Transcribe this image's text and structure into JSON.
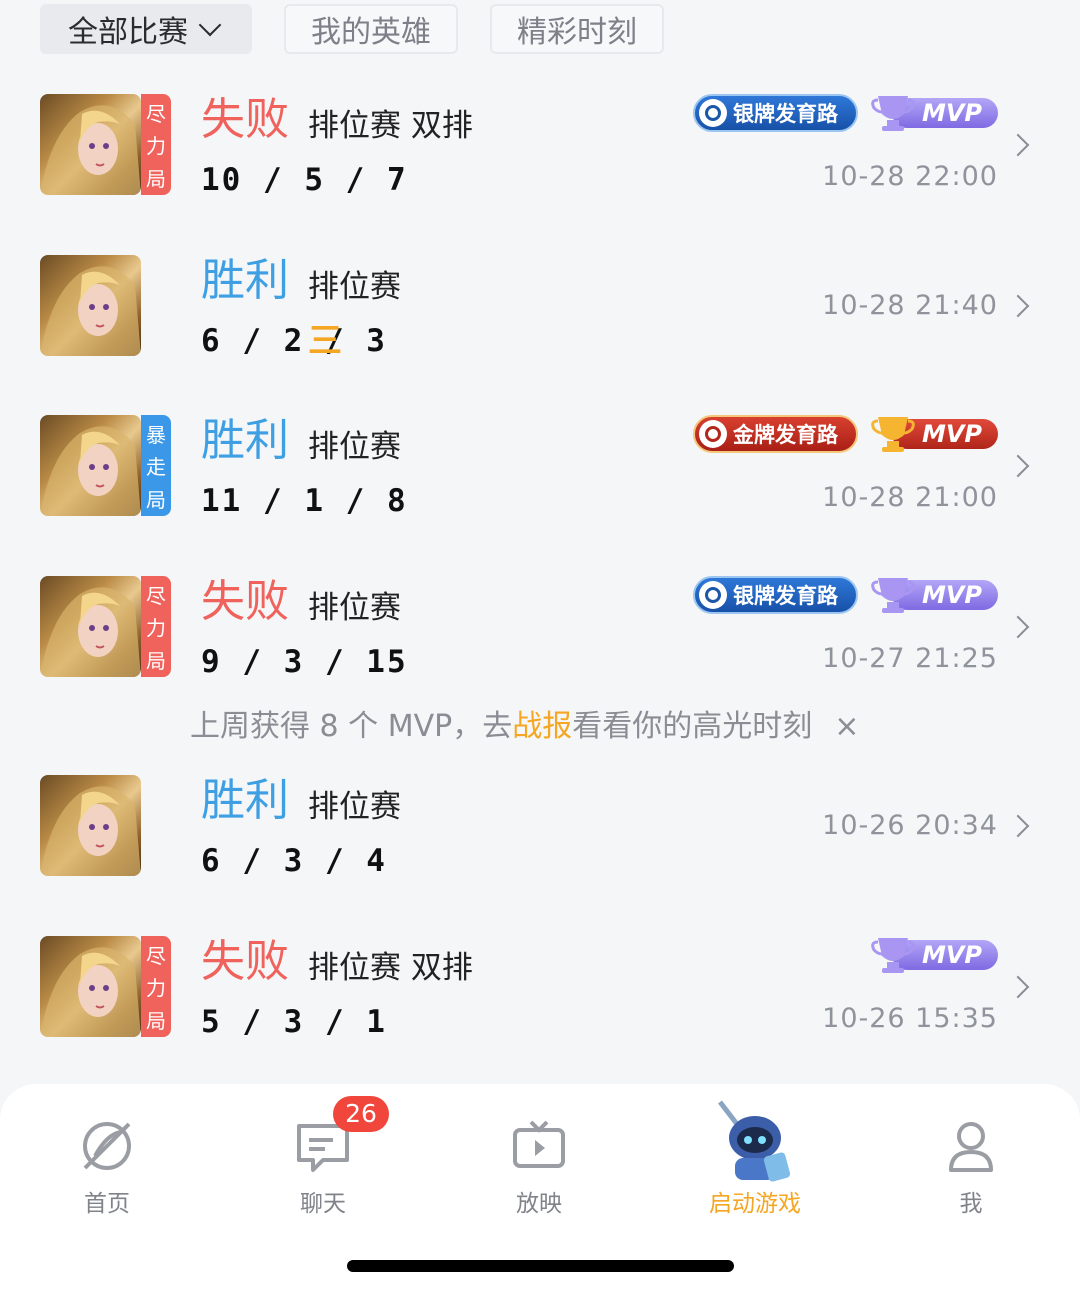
{
  "filters": [
    {
      "label": "全部比赛",
      "active": true
    },
    {
      "label": "我的英雄",
      "active": false
    },
    {
      "label": "精彩时刻",
      "active": false
    }
  ],
  "matches": [
    {
      "tag": [
        "尽",
        "力",
        "局"
      ],
      "tag_color": "red",
      "result": "失败",
      "result_type": "lose",
      "mode": "排位赛 双排",
      "kda": "10 / 5 / 7",
      "rank_badge": "银牌发育路",
      "rank_type": "silver",
      "mvp": "MVP",
      "mvp_type": "purple",
      "time": "10-28 22:00"
    },
    {
      "tag": null,
      "result": "胜利",
      "result_type": "win",
      "mode": "排位赛",
      "kda": "6 / 2 / 3",
      "triple": "三",
      "time": "10-28 21:40"
    },
    {
      "tag": [
        "暴",
        "走",
        "局"
      ],
      "tag_color": "blue",
      "result": "胜利",
      "result_type": "win",
      "mode": "排位赛",
      "kda": "11 / 1 / 8",
      "rank_badge": "金牌发育路",
      "rank_type": "gold",
      "mvp": "MVP",
      "mvp_type": "red",
      "time": "10-28 21:00"
    },
    {
      "tag": [
        "尽",
        "力",
        "局"
      ],
      "tag_color": "red",
      "result": "失败",
      "result_type": "lose",
      "mode": "排位赛",
      "kda": "9 / 3 / 15",
      "rank_badge": "银牌发育路",
      "rank_type": "silver",
      "mvp": "MVP",
      "mvp_type": "purple",
      "time": "10-27 21:25"
    },
    {
      "tag": null,
      "result": "胜利",
      "result_type": "win",
      "mode": "排位赛",
      "kda": "6 / 3 / 4",
      "time": "10-26 20:34"
    },
    {
      "tag": [
        "尽",
        "力",
        "局"
      ],
      "tag_color": "red",
      "result": "失败",
      "result_type": "lose",
      "mode": "排位赛 双排",
      "kda": "5 / 3 / 1",
      "mvp": "MVP",
      "mvp_type": "purple",
      "time": "10-26 15:35"
    }
  ],
  "notice": {
    "prefix": "上周获得 8 个 MVP，去",
    "highlight": "战报",
    "suffix": "看看你的高光时刻",
    "close": "×"
  },
  "nav": {
    "items": [
      {
        "label": "首页",
        "icon": "home-icon"
      },
      {
        "label": "聊天",
        "icon": "chat-icon",
        "badge": "26"
      },
      {
        "label": "放映",
        "icon": "tv-icon"
      },
      {
        "label": "启动游戏",
        "icon": "game-mascot-icon",
        "active": true
      },
      {
        "label": "我",
        "icon": "profile-icon"
      }
    ]
  },
  "colors": {
    "lose": "#f0625c",
    "win": "#3f9fe3",
    "accent": "#f5a623"
  }
}
